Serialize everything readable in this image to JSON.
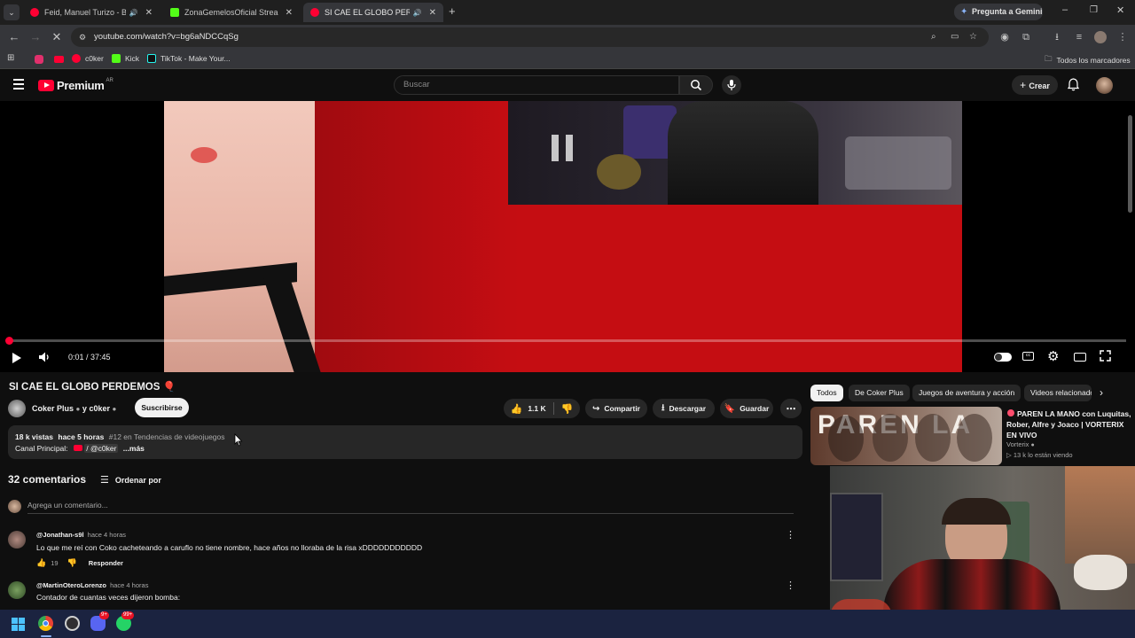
{
  "browser": {
    "tabs": [
      {
        "title": "Feid, Manuel Turizo - BORR",
        "fav_color": "#ff0033"
      },
      {
        "title": "ZonaGemelosOficial Stream - V",
        "fav_color": "#53fc18"
      },
      {
        "title": "SI CAE EL GLOBO PERDEMO",
        "fav_color": "#ff0033"
      }
    ],
    "gemini_button": "Pregunta a Gemini",
    "url": "youtube.com/watch?v=bg6aNDCCqSg",
    "bookmarks": [
      {
        "label": "c0ker",
        "icon_color": "#ffffff"
      },
      {
        "label": "Kick",
        "icon_color": "#53fc18"
      },
      {
        "label": "TikTok - Make Your...",
        "icon_color": "#ffffff"
      }
    ],
    "all_bookmarks": "Todos los marcadores"
  },
  "youtube": {
    "logo": "Premium",
    "region": "AR",
    "search_placeholder": "Buscar",
    "create_label": "Crear"
  },
  "player": {
    "time": "0:01 / 37:45",
    "progress": 0.0004
  },
  "video_info": {
    "title": "SI CAE EL GLOBO PERDEMOS",
    "channel": "Coker Plus",
    "collab_separator": "y",
    "collab": "c0ker",
    "subscribe": "Suscribirse",
    "likes": "1.1 K",
    "share": "Compartir",
    "download": "Descargar",
    "save": "Guardar",
    "views": "18 k vistas",
    "age": "hace 5 horas",
    "trending": "#12 en Tendencias de videojuegos",
    "main_channel_label": "Canal Principal:",
    "main_channel_handle": "/ @c0ker",
    "more": "...más"
  },
  "comments": {
    "count": "32 comentarios",
    "sort": "Ordenar por",
    "add_placeholder": "Agrega un comentario...",
    "items": [
      {
        "author": "@Jonathan-s9l",
        "time": "hace 4 horas",
        "text": "Lo que me reí con Coko cacheteando a caruflo no tiene nombre, hace años no lloraba de la risa xDDDDDDDDDDD",
        "likes": "19",
        "reply": "Responder"
      },
      {
        "author": "@MartinOteroLorenzo",
        "time": "hace 4 horas",
        "text": "Contador de cuantas veces dijeron bomba:"
      }
    ]
  },
  "sidebar": {
    "chips": [
      "Todos",
      "De Coker Plus",
      "Juegos de aventura y acción",
      "Videos relacionados"
    ],
    "rec": {
      "title": "PAREN LA MANO con Luquitas, Rober, Alfre y Joaco | VORTERIX EN VIVO",
      "channel": "Vorterix",
      "viewers": "13 k lo están viendo",
      "thumb_text": "PAREN LA"
    }
  },
  "taskbar": {
    "badge_discord": "9+",
    "badge_whatsapp": "99+"
  },
  "colors": {
    "yt_red": "#ff0033",
    "bg": "#0f0f0f",
    "chip": "#272727"
  }
}
